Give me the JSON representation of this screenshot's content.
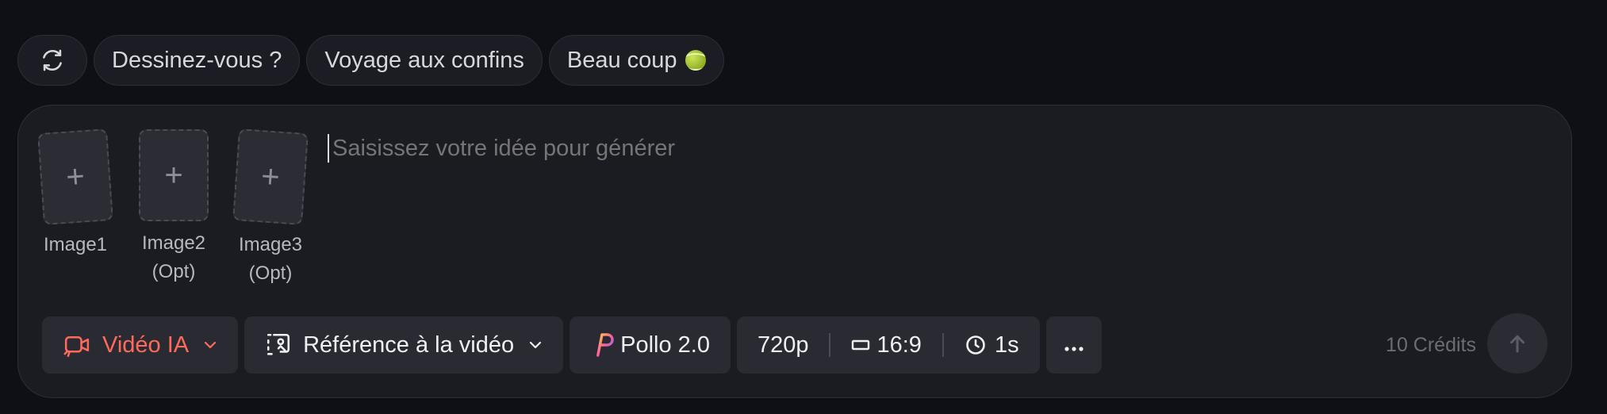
{
  "suggestions": {
    "refresh_icon": "refresh-icon",
    "chips": [
      {
        "label": "Dessinez-vous ?"
      },
      {
        "label": "Voyage aux confins"
      },
      {
        "label": "Beau coup"
      }
    ],
    "chip3_emoji_icon": "tennis-ball-icon"
  },
  "images": [
    {
      "label_line1": "Image1",
      "label_line2": ""
    },
    {
      "label_line1": "Image2",
      "label_line2": "(Opt)"
    },
    {
      "label_line1": "Image3",
      "label_line2": "(Opt)"
    }
  ],
  "prompt": {
    "placeholder": "Saisissez votre idée pour générer",
    "value": ""
  },
  "toolbar": {
    "mode_label": "Vidéo IA",
    "reference_label": "Référence à la vidéo",
    "model_label": "Pollo 2.0",
    "resolution": "720p",
    "aspect_ratio": "16:9",
    "duration": "1s",
    "more_icon": "more-horizontal-icon"
  },
  "credits": "10 Crédits",
  "colors": {
    "accent": "#ff6a5c",
    "panel": "#1b1c22",
    "background": "#0f1015"
  }
}
